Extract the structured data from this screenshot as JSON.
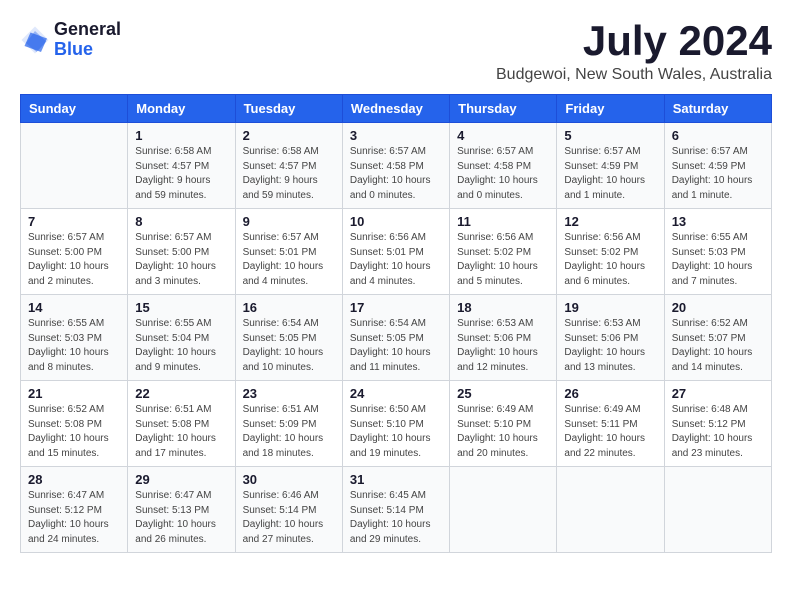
{
  "logo": {
    "general": "General",
    "blue": "Blue"
  },
  "title": {
    "month": "July 2024",
    "location": "Budgewoi, New South Wales, Australia"
  },
  "headers": [
    "Sunday",
    "Monday",
    "Tuesday",
    "Wednesday",
    "Thursday",
    "Friday",
    "Saturday"
  ],
  "weeks": [
    [
      {
        "day": "",
        "info": ""
      },
      {
        "day": "1",
        "info": "Sunrise: 6:58 AM\nSunset: 4:57 PM\nDaylight: 9 hours\nand 59 minutes."
      },
      {
        "day": "2",
        "info": "Sunrise: 6:58 AM\nSunset: 4:57 PM\nDaylight: 9 hours\nand 59 minutes."
      },
      {
        "day": "3",
        "info": "Sunrise: 6:57 AM\nSunset: 4:58 PM\nDaylight: 10 hours\nand 0 minutes."
      },
      {
        "day": "4",
        "info": "Sunrise: 6:57 AM\nSunset: 4:58 PM\nDaylight: 10 hours\nand 0 minutes."
      },
      {
        "day": "5",
        "info": "Sunrise: 6:57 AM\nSunset: 4:59 PM\nDaylight: 10 hours\nand 1 minute."
      },
      {
        "day": "6",
        "info": "Sunrise: 6:57 AM\nSunset: 4:59 PM\nDaylight: 10 hours\nand 1 minute."
      }
    ],
    [
      {
        "day": "7",
        "info": "Sunrise: 6:57 AM\nSunset: 5:00 PM\nDaylight: 10 hours\nand 2 minutes."
      },
      {
        "day": "8",
        "info": "Sunrise: 6:57 AM\nSunset: 5:00 PM\nDaylight: 10 hours\nand 3 minutes."
      },
      {
        "day": "9",
        "info": "Sunrise: 6:57 AM\nSunset: 5:01 PM\nDaylight: 10 hours\nand 4 minutes."
      },
      {
        "day": "10",
        "info": "Sunrise: 6:56 AM\nSunset: 5:01 PM\nDaylight: 10 hours\nand 4 minutes."
      },
      {
        "day": "11",
        "info": "Sunrise: 6:56 AM\nSunset: 5:02 PM\nDaylight: 10 hours\nand 5 minutes."
      },
      {
        "day": "12",
        "info": "Sunrise: 6:56 AM\nSunset: 5:02 PM\nDaylight: 10 hours\nand 6 minutes."
      },
      {
        "day": "13",
        "info": "Sunrise: 6:55 AM\nSunset: 5:03 PM\nDaylight: 10 hours\nand 7 minutes."
      }
    ],
    [
      {
        "day": "14",
        "info": "Sunrise: 6:55 AM\nSunset: 5:03 PM\nDaylight: 10 hours\nand 8 minutes."
      },
      {
        "day": "15",
        "info": "Sunrise: 6:55 AM\nSunset: 5:04 PM\nDaylight: 10 hours\nand 9 minutes."
      },
      {
        "day": "16",
        "info": "Sunrise: 6:54 AM\nSunset: 5:05 PM\nDaylight: 10 hours\nand 10 minutes."
      },
      {
        "day": "17",
        "info": "Sunrise: 6:54 AM\nSunset: 5:05 PM\nDaylight: 10 hours\nand 11 minutes."
      },
      {
        "day": "18",
        "info": "Sunrise: 6:53 AM\nSunset: 5:06 PM\nDaylight: 10 hours\nand 12 minutes."
      },
      {
        "day": "19",
        "info": "Sunrise: 6:53 AM\nSunset: 5:06 PM\nDaylight: 10 hours\nand 13 minutes."
      },
      {
        "day": "20",
        "info": "Sunrise: 6:52 AM\nSunset: 5:07 PM\nDaylight: 10 hours\nand 14 minutes."
      }
    ],
    [
      {
        "day": "21",
        "info": "Sunrise: 6:52 AM\nSunset: 5:08 PM\nDaylight: 10 hours\nand 15 minutes."
      },
      {
        "day": "22",
        "info": "Sunrise: 6:51 AM\nSunset: 5:08 PM\nDaylight: 10 hours\nand 17 minutes."
      },
      {
        "day": "23",
        "info": "Sunrise: 6:51 AM\nSunset: 5:09 PM\nDaylight: 10 hours\nand 18 minutes."
      },
      {
        "day": "24",
        "info": "Sunrise: 6:50 AM\nSunset: 5:10 PM\nDaylight: 10 hours\nand 19 minutes."
      },
      {
        "day": "25",
        "info": "Sunrise: 6:49 AM\nSunset: 5:10 PM\nDaylight: 10 hours\nand 20 minutes."
      },
      {
        "day": "26",
        "info": "Sunrise: 6:49 AM\nSunset: 5:11 PM\nDaylight: 10 hours\nand 22 minutes."
      },
      {
        "day": "27",
        "info": "Sunrise: 6:48 AM\nSunset: 5:12 PM\nDaylight: 10 hours\nand 23 minutes."
      }
    ],
    [
      {
        "day": "28",
        "info": "Sunrise: 6:47 AM\nSunset: 5:12 PM\nDaylight: 10 hours\nand 24 minutes."
      },
      {
        "day": "29",
        "info": "Sunrise: 6:47 AM\nSunset: 5:13 PM\nDaylight: 10 hours\nand 26 minutes."
      },
      {
        "day": "30",
        "info": "Sunrise: 6:46 AM\nSunset: 5:14 PM\nDaylight: 10 hours\nand 27 minutes."
      },
      {
        "day": "31",
        "info": "Sunrise: 6:45 AM\nSunset: 5:14 PM\nDaylight: 10 hours\nand 29 minutes."
      },
      {
        "day": "",
        "info": ""
      },
      {
        "day": "",
        "info": ""
      },
      {
        "day": "",
        "info": ""
      }
    ]
  ]
}
